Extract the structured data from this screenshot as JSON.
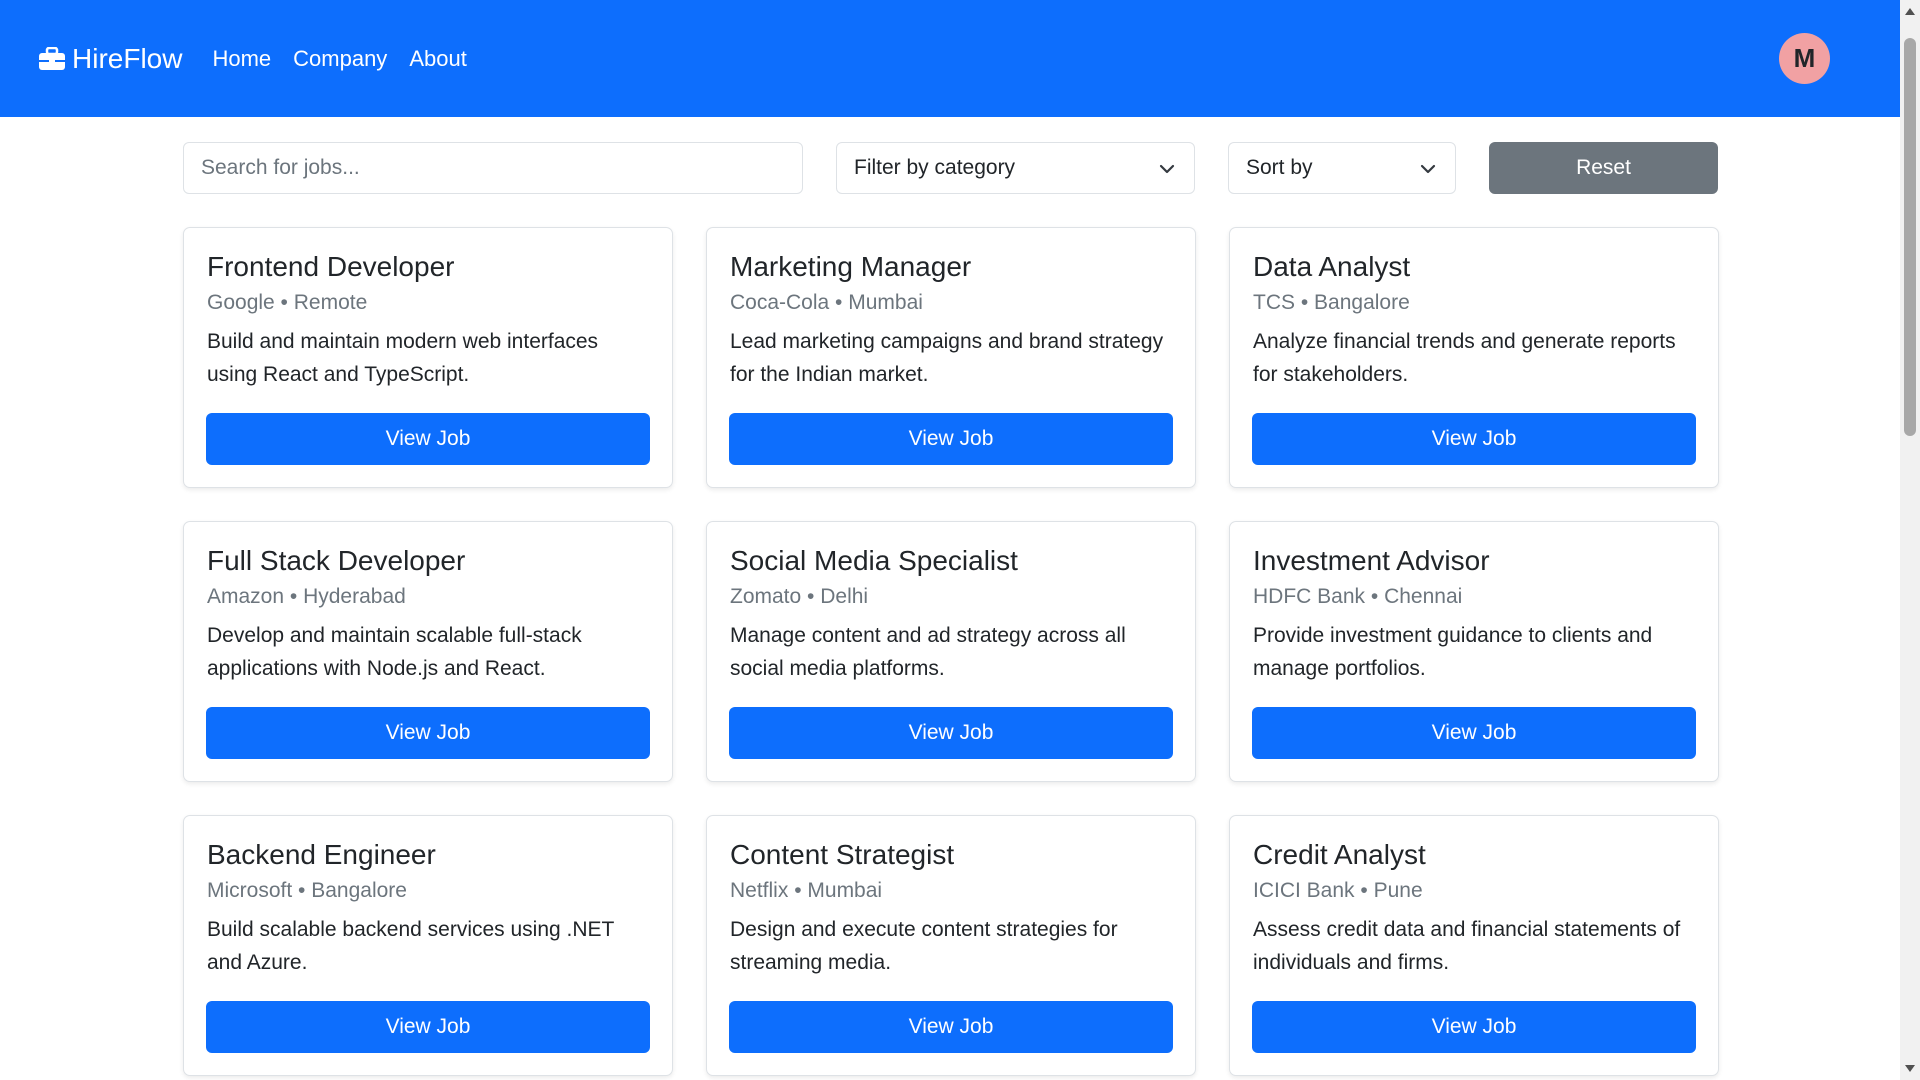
{
  "brand": {
    "name": "HireFlow",
    "icon": "briefcase-icon"
  },
  "nav": {
    "links": [
      {
        "label": "Home"
      },
      {
        "label": "Company"
      },
      {
        "label": "About"
      }
    ]
  },
  "user": {
    "avatar_initial": "M"
  },
  "colors": {
    "primary": "#0d6efd",
    "secondary": "#6c757d",
    "avatar_bg": "#f1a1a3"
  },
  "filters": {
    "search_placeholder": "Search for jobs...",
    "category_label": "Filter by category",
    "sort_label": "Sort by",
    "reset_label": "Reset"
  },
  "jobs": [
    {
      "title": "Frontend Developer",
      "company": "Google",
      "location": "Remote",
      "description": "Build and maintain modern web interfaces using React and TypeScript.",
      "button": "View Job"
    },
    {
      "title": "Marketing Manager",
      "company": "Coca-Cola",
      "location": "Mumbai",
      "description": "Lead marketing campaigns and brand strategy for the Indian market.",
      "button": "View Job"
    },
    {
      "title": "Data Analyst",
      "company": "TCS",
      "location": "Bangalore",
      "description": "Analyze financial trends and generate reports for stakeholders.",
      "button": "View Job"
    },
    {
      "title": "Full Stack Developer",
      "company": "Amazon",
      "location": "Hyderabad",
      "description": "Develop and maintain scalable full-stack applications with Node.js and React.",
      "button": "View Job"
    },
    {
      "title": "Social Media Specialist",
      "company": "Zomato",
      "location": "Delhi",
      "description": "Manage content and ad strategy across all social media platforms.",
      "button": "View Job"
    },
    {
      "title": "Investment Advisor",
      "company": "HDFC Bank",
      "location": "Chennai",
      "description": "Provide investment guidance to clients and manage portfolios.",
      "button": "View Job"
    },
    {
      "title": "Backend Engineer",
      "company": "Microsoft",
      "location": "Bangalore",
      "description": "Build scalable backend services using .NET and Azure.",
      "button": "View Job"
    },
    {
      "title": "Content Strategist",
      "company": "Netflix",
      "location": "Mumbai",
      "description": "Design and execute content strategies for streaming media.",
      "button": "View Job"
    },
    {
      "title": "Credit Analyst",
      "company": "ICICI Bank",
      "location": "Pune",
      "description": "Assess credit data and financial statements of individuals and firms.",
      "button": "View Job"
    }
  ]
}
